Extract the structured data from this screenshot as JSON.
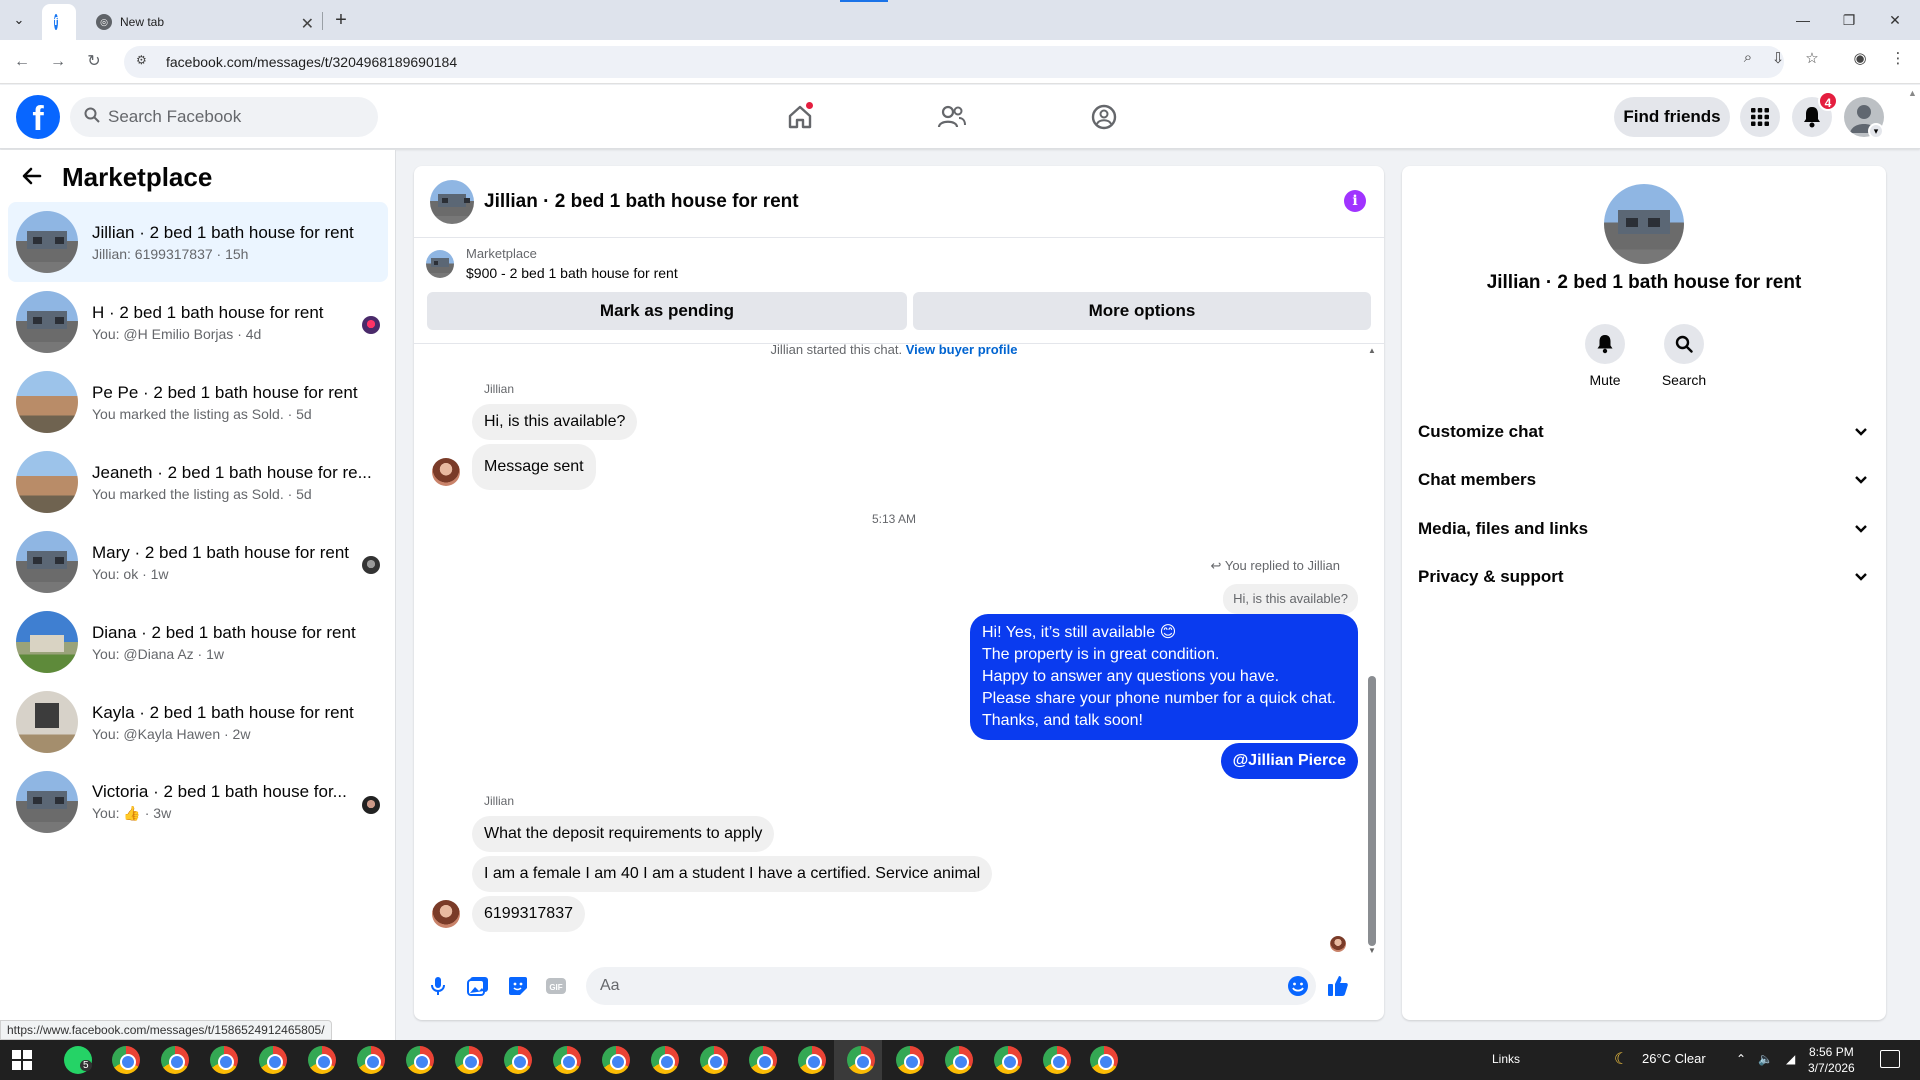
{
  "browser": {
    "active_tab_icon": "facebook-icon",
    "new_tab_label": "New tab",
    "url": "facebook.com/messages/t/3204968189690184",
    "status_url": "https://www.facebook.com/messages/t/1586524912465805/"
  },
  "fb_header": {
    "search_placeholder": "Search Facebook",
    "find_friends": "Find friends",
    "notification_count": "4"
  },
  "sidebar": {
    "title": "Marketplace",
    "conversations": [
      {
        "name": "Jillian · 2 bed 1 bath house for rent",
        "sub": "Jillian: 6199317837 · 15h",
        "active": true
      },
      {
        "name": "H · 2 bed 1 bath house for rent",
        "sub": "You: @H Emilio Borjas · 4d"
      },
      {
        "name": "Pe Pe · 2 bed 1 bath house for rent",
        "sub": "You marked the listing as Sold. · 5d"
      },
      {
        "name": "Jeaneth · 2 bed 1 bath house for re...",
        "sub": "You marked the listing as Sold. · 5d"
      },
      {
        "name": "Mary · 2 bed 1 bath house for rent",
        "sub": "You: ok · 1w"
      },
      {
        "name": "Diana · 2 bed 1 bath house for rent",
        "sub": "You: @Diana Az · 1w"
      },
      {
        "name": "Kayla · 2 bed 1 bath house for rent",
        "sub": "You: @Kayla Hawen · 2w"
      },
      {
        "name": "Victoria · 2 bed 1 bath house for...",
        "sub": "You: 👍 · 3w"
      }
    ]
  },
  "chat": {
    "title": "Jillian · 2 bed 1 bath house for rent",
    "listing_category": "Marketplace",
    "listing_price_title": "$900 - 2 bed 1 bath house for rent",
    "mark_pending": "Mark as pending",
    "more_options": "More options",
    "started_text": "Jillian started this chat.",
    "view_buyer_profile": "View buyer profile",
    "sender_name": "Jillian",
    "msg1": "Hi, is this available?",
    "msg2": "Message sent",
    "timestamp": "5:13 AM",
    "replied_note": "You replied to Jillian",
    "reply_quote": "Hi, is this available?",
    "own_message_lines": [
      "Hi! Yes, it’s still available 😊",
      "The property is in great condition.",
      "Happy to answer any questions you have.",
      "Please share your phone number for a quick chat.",
      "Thanks, and talk soon!"
    ],
    "mention": "@Jillian Pierce",
    "msg3": "What the deposit requirements to apply",
    "msg4": "I am a female I am 40 I am a student I have a certified. Service animal",
    "msg5": "6199317837",
    "composer_placeholder": "Aa"
  },
  "info_panel": {
    "name": "Jillian · 2 bed 1 bath house for rent",
    "mute": "Mute",
    "search": "Search",
    "sections": [
      "Customize chat",
      "Chat members",
      "Media, files and links",
      "Privacy & support"
    ]
  },
  "taskbar": {
    "whatsapp_badge": "5",
    "links": "Links",
    "weather": "26°C  Clear",
    "time": "8:56 PM",
    "date": "3/7/2026"
  },
  "colors": {
    "fb_blue": "#0866ff",
    "own_bubble": "#0a3bef",
    "info_purple": "#a033ff",
    "badge_red": "#e41e3f"
  }
}
